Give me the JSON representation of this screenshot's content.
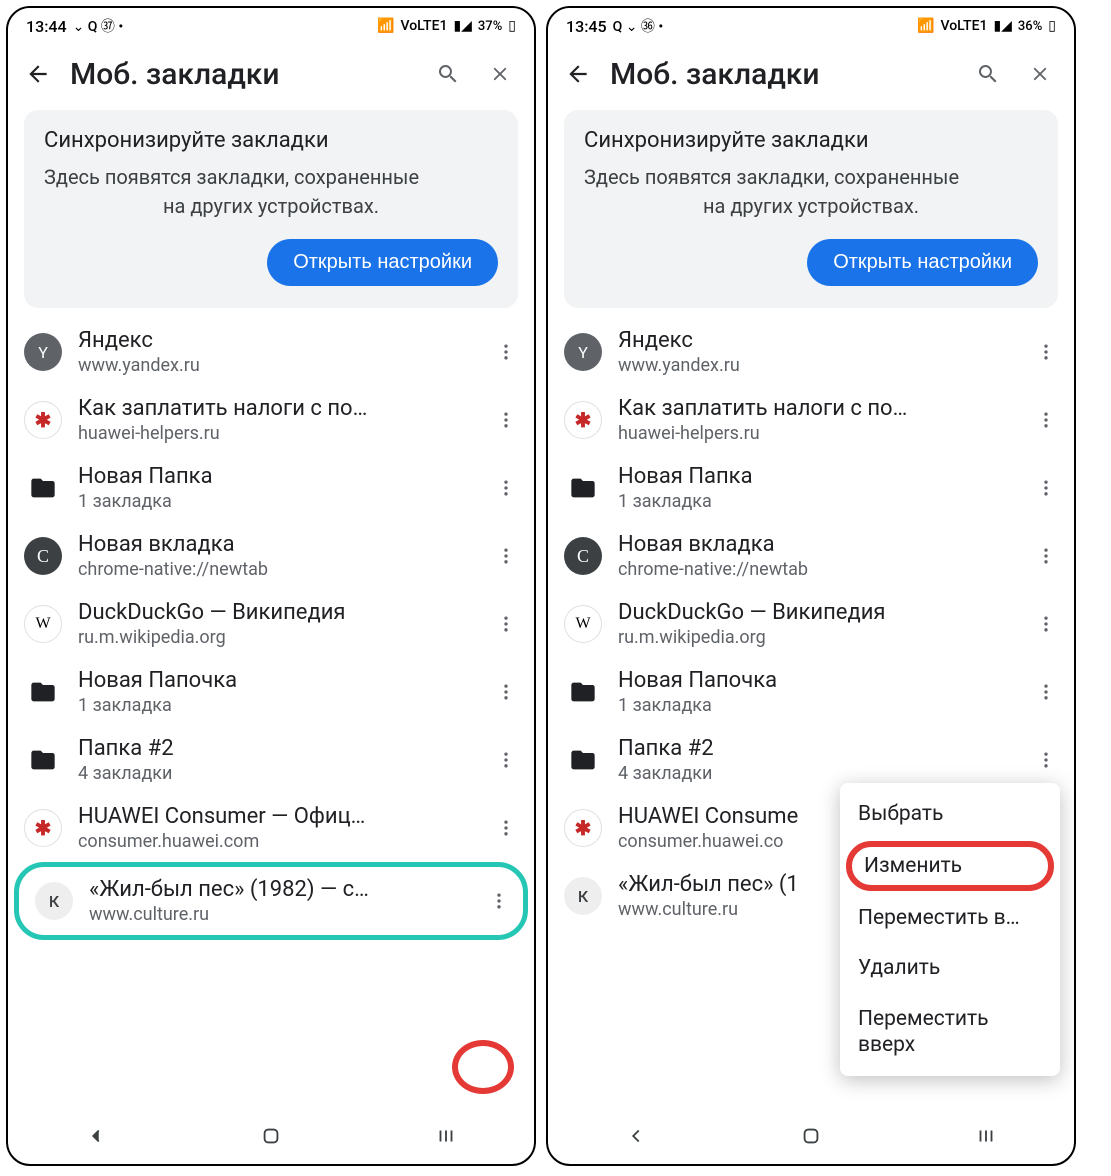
{
  "screens": [
    {
      "status": {
        "time": "13:44",
        "battery": "37%",
        "indicators": "⌄ Q ㊲ •",
        "net": "VoLTE1"
      },
      "header": {
        "title": "Моб. закладки"
      },
      "sync": {
        "title": "Синхронизируйте закладки",
        "body_line1": "Здесь появятся закладки, сохраненные",
        "body_line2": "на других устройствах.",
        "button": "Открыть настройки"
      },
      "items": [
        {
          "title": "Яндекс",
          "sub": "www.yandex.ru",
          "icon": "Y",
          "style": "fv-grey"
        },
        {
          "title": "Как заплатить налоги с по…",
          "sub": "huawei-helpers.ru",
          "icon": "✱",
          "style": "fv-wht"
        },
        {
          "title": "Новая Папка",
          "sub": "1 закладка",
          "folder": true
        },
        {
          "title": "Новая вкладка",
          "sub": "chrome-native://newtab",
          "icon": "C",
          "style": "fv-dark"
        },
        {
          "title": "DuckDuckGo — Википедия",
          "sub": "ru.m.wikipedia.org",
          "icon": "W",
          "style": "fv-w"
        },
        {
          "title": "Новая Папочка",
          "sub": "1 закладка",
          "folder": true
        },
        {
          "title": "Папка #2",
          "sub": "4 закладки",
          "folder": true
        },
        {
          "title": "HUAWEI Consumer — Офиц…",
          "sub": "consumer.huawei.com",
          "icon": "✱",
          "style": "fv-wht"
        },
        {
          "title": "«Жил-был пес» (1982) — с…",
          "sub": "www.culture.ru",
          "icon": "К",
          "style": "fv-k",
          "highlight": true
        }
      ]
    },
    {
      "status": {
        "time": "13:45",
        "battery": "36%",
        "indicators": "Q ⌄ ㊱ •",
        "net": "VoLTE1"
      },
      "header": {
        "title": "Моб. закладки"
      },
      "sync": {
        "title": "Синхронизируйте закладки",
        "body_line1": "Здесь появятся закладки, сохраненные",
        "body_line2": "на других устройствах.",
        "button": "Открыть настройки"
      },
      "items": [
        {
          "title": "Яндекс",
          "sub": "www.yandex.ru",
          "icon": "Y",
          "style": "fv-grey"
        },
        {
          "title": "Как заплатить налоги с по…",
          "sub": "huawei-helpers.ru",
          "icon": "✱",
          "style": "fv-wht"
        },
        {
          "title": "Новая Папка",
          "sub": "1 закладка",
          "folder": true
        },
        {
          "title": "Новая вкладка",
          "sub": "chrome-native://newtab",
          "icon": "C",
          "style": "fv-dark"
        },
        {
          "title": "DuckDuckGo — Википедия",
          "sub": "ru.m.wikipedia.org",
          "icon": "W",
          "style": "fv-w"
        },
        {
          "title": "Новая Папочка",
          "sub": "1 закладка",
          "folder": true
        },
        {
          "title": "Папка #2",
          "sub": "4 закладки",
          "folder": true
        },
        {
          "title": "HUAWEI Consume",
          "sub": "consumer.huawei.co",
          "icon": "✱",
          "style": "fv-wht"
        },
        {
          "title": "«Жил-был пес» (1",
          "sub": "www.culture.ru",
          "icon": "К",
          "style": "fv-k"
        }
      ],
      "context_menu": [
        "Выбрать",
        "Изменить",
        "Переместить в…",
        "Удалить",
        "Переместить вверх"
      ],
      "context_highlight_index": 1
    }
  ]
}
